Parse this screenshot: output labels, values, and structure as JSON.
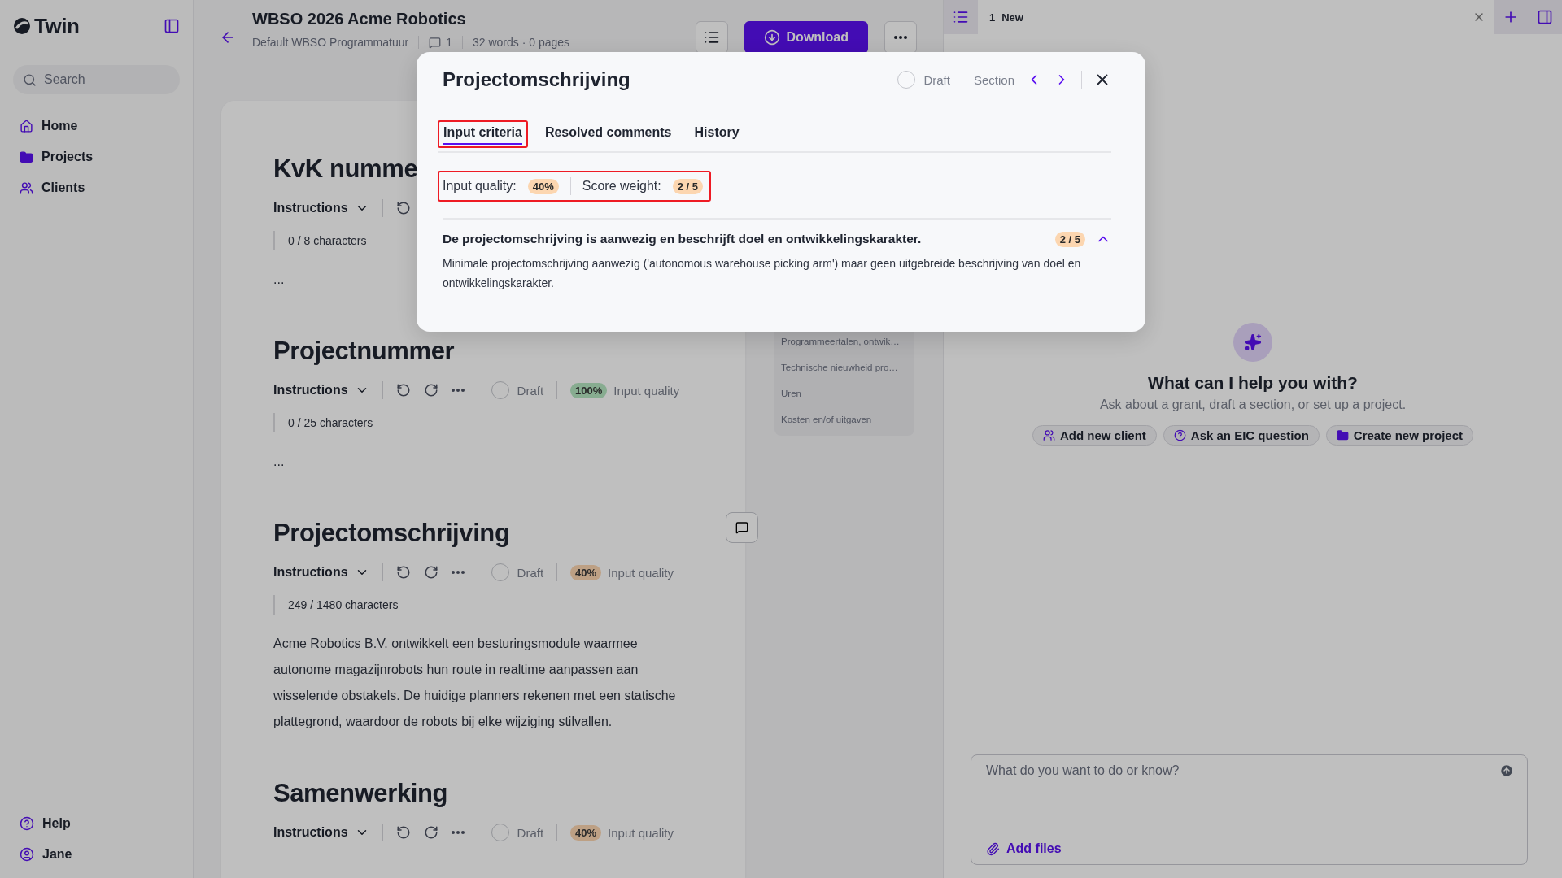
{
  "sidebar": {
    "logo": "Twin",
    "search": {
      "placeholder": "Search"
    },
    "nav": [
      {
        "label": "Home"
      },
      {
        "label": "Projects"
      },
      {
        "label": "Clients"
      }
    ],
    "footer": [
      {
        "label": "Help"
      },
      {
        "label": "Jane"
      }
    ]
  },
  "header": {
    "title": "WBSO 2026 Acme Robotics",
    "program": "Default WBSO Programmatuur",
    "comments": "1",
    "stats": "32 words · 0 pages",
    "download": "Download"
  },
  "sections": [
    {
      "title": "KvK numme",
      "instructions": "Instructions",
      "tools": [
        {
          "kind": "undo"
        }
      ],
      "count": "0 / 8 characters",
      "body": "..."
    },
    {
      "title": "Projectnummer",
      "instructions": "Instructions",
      "tools": [
        {
          "kind": "undo"
        },
        {
          "kind": "redo"
        },
        {
          "kind": "more"
        }
      ],
      "draft": {
        "label": "Draft",
        "checked": false
      },
      "quality": {
        "value": "100%",
        "label": "Input quality",
        "color": "#87ac90"
      },
      "count": "0 / 25 characters",
      "body": "..."
    },
    {
      "title": "Projectomschrijving",
      "instructions": "Instructions",
      "tools": [
        {
          "kind": "undo"
        },
        {
          "kind": "redo"
        },
        {
          "kind": "more"
        }
      ],
      "draft": {
        "label": "Draft",
        "checked": false
      },
      "quality": {
        "value": "40%",
        "label": "Input quality",
        "color": "#bda084"
      },
      "count": "249 / 1480 characters",
      "body": "Acme Robotics B.V. ontwikkelt een besturingsmodule waarmee autonome magazijnrobots hun route in realtime aanpassen aan wisselende obstakels. De huidige planners rekenen met een statische plattegrond, waardoor de robots bij elke wijziging stilvallen.",
      "comment_button": true
    },
    {
      "title": "Samenwerking",
      "instructions": "Instructions",
      "tools": [
        {
          "kind": "undo"
        },
        {
          "kind": "redo"
        },
        {
          "kind": "more"
        }
      ],
      "draft": {
        "label": "Draft",
        "checked": false
      },
      "quality": {
        "value": "40%",
        "label": "Input quality",
        "color": "#bda084"
      }
    }
  ],
  "outline": [
    "Programmeertalen, ontwik…",
    "Technische nieuwheid pro…",
    "Uren",
    "Kosten en/of uitgaven"
  ],
  "modal": {
    "title": "Projectomschrijving",
    "draft": {
      "label": "Draft",
      "checked": false
    },
    "section_label": "Section",
    "tabs": [
      {
        "label": "Input criteria",
        "selected": true,
        "highlighted": true
      },
      {
        "label": "Resolved comments",
        "selected": false,
        "highlighted": false
      },
      {
        "label": "History",
        "selected": false,
        "highlighted": false
      }
    ],
    "quality_row": {
      "highlighted": true,
      "quality_label": "Input quality:",
      "quality": "40%",
      "weight_label": "Score weight:",
      "weight": "2 / 5"
    },
    "criteria": [
      {
        "title": "De projectomschrijving is aanwezig en beschrijft doel en ontwikkelingskarakter.",
        "score": "2 / 5",
        "expanded": true,
        "description": "Minimale projectomschrijving aanwezig ('autonomous warehouse picking arm') maar geen uitgebreide beschrijving van doel en ontwikkelingskarakter."
      }
    ]
  },
  "chat": {
    "tabs": [
      {
        "number": "1",
        "label": "New"
      }
    ],
    "heading": "What can I help you with?",
    "subtitle": "Ask about a grant, draft a section, or set up a project.",
    "suggestions": [
      {
        "label": "Add new client"
      },
      {
        "label": "Ask an EIC question"
      },
      {
        "label": "Create new project"
      }
    ],
    "input": {
      "placeholder": "What do you want to do or know?"
    },
    "attach": "Add files"
  }
}
